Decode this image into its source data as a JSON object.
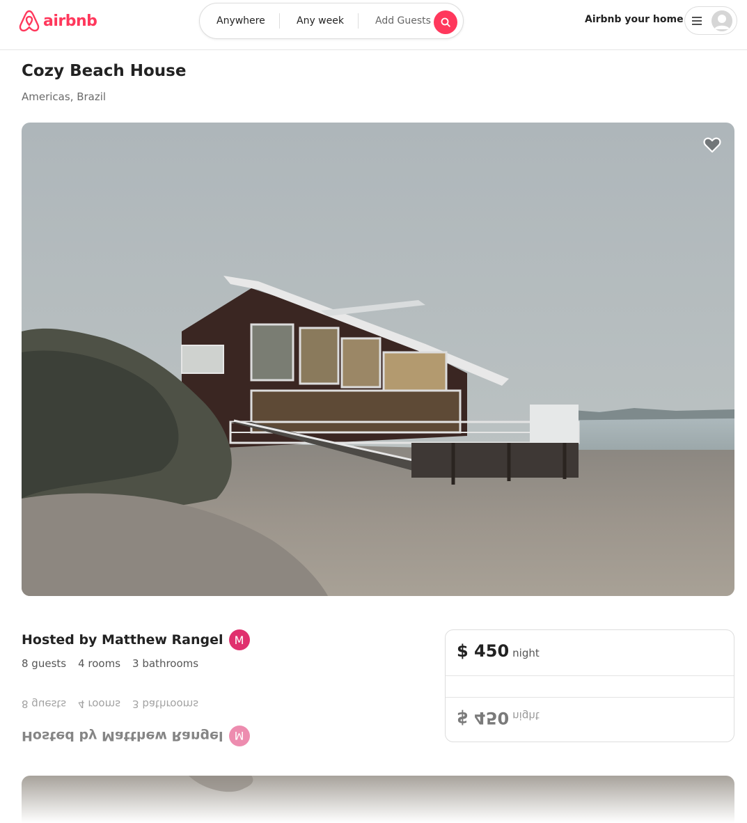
{
  "header": {
    "logo_text": "airbnb",
    "search": {
      "location": "Anywhere",
      "week": "Any week",
      "guests": "Add Guests"
    },
    "host_link": "Airbnb your home"
  },
  "listing": {
    "title": "Cozy Beach House",
    "location": "Americas, Brazil",
    "host_line": "Hosted by Matthew Rangel",
    "host_initial": "M",
    "stats": [
      "8 guests",
      "4 rooms",
      "3 bathrooms"
    ],
    "price": {
      "amount": "$ 450",
      "unit": "night"
    }
  },
  "colors": {
    "brand": "#ff385c",
    "host_avatar": "#e0306e"
  },
  "icons": [
    "airbnb-logo-icon",
    "search-icon",
    "menu-icon",
    "user-avatar-icon",
    "heart-icon"
  ]
}
